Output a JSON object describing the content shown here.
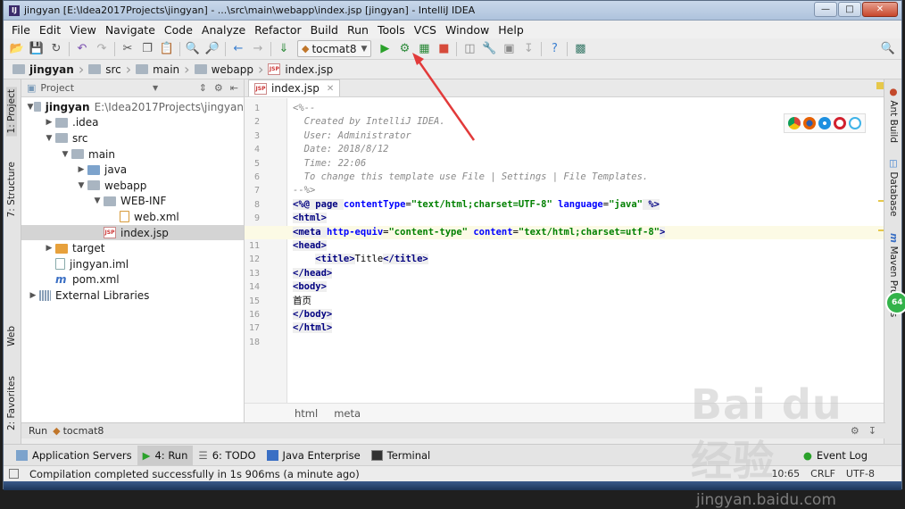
{
  "window": {
    "title": "jingyan [E:\\Idea2017Projects\\jingyan] - ...\\src\\main\\webapp\\index.jsp [jingyan] - IntelliJ IDEA",
    "app_icon": "IJ"
  },
  "menu": [
    "File",
    "Edit",
    "View",
    "Navigate",
    "Code",
    "Analyze",
    "Refactor",
    "Build",
    "Run",
    "Tools",
    "VCS",
    "Window",
    "Help"
  ],
  "toolbar": {
    "run_config": "tocmat8"
  },
  "breadcrumb": [
    {
      "label": "jingyan",
      "bold": true
    },
    {
      "label": "src"
    },
    {
      "label": "main"
    },
    {
      "label": "webapp"
    },
    {
      "label": "index.jsp"
    }
  ],
  "left_strip": {
    "project": "1: Project",
    "structure": "7: Structure",
    "web": "Web",
    "favorites": "2: Favorites"
  },
  "right_strip": {
    "ant": "Ant Build",
    "database": "Database",
    "maven": "Maven Projects"
  },
  "project_panel": {
    "title": "Project",
    "tree": [
      {
        "label": "jingyan",
        "path": "E:\\Idea2017Projects\\jingyan",
        "icon": "module",
        "depth": 0,
        "arrow": "down"
      },
      {
        "label": ".idea",
        "icon": "folder",
        "depth": 1,
        "arrow": "right"
      },
      {
        "label": "src",
        "icon": "folder",
        "depth": 1,
        "arrow": "down"
      },
      {
        "label": "main",
        "icon": "folder",
        "depth": 2,
        "arrow": "down"
      },
      {
        "label": "java",
        "icon": "source-folder",
        "depth": 3,
        "arrow": "right"
      },
      {
        "label": "webapp",
        "icon": "web-folder",
        "depth": 3,
        "arrow": "down"
      },
      {
        "label": "WEB-INF",
        "icon": "folder",
        "depth": 4,
        "arrow": "down"
      },
      {
        "label": "web.xml",
        "icon": "xml-file",
        "depth": 5,
        "arrow": ""
      },
      {
        "label": "index.jsp",
        "icon": "jsp-file",
        "depth": 4,
        "arrow": "",
        "selected": true
      },
      {
        "label": "target",
        "icon": "excluded-folder",
        "depth": 1,
        "arrow": "right"
      },
      {
        "label": "jingyan.iml",
        "icon": "iml-file",
        "depth": 1,
        "arrow": ""
      },
      {
        "label": "pom.xml",
        "icon": "maven-file",
        "depth": 1,
        "arrow": ""
      },
      {
        "label": "External Libraries",
        "icon": "library",
        "depth": 0,
        "arrow": "right"
      }
    ]
  },
  "editor": {
    "tab": "index.jsp",
    "line_numbers": [
      "1",
      "2",
      "3",
      "4",
      "5",
      "6",
      "7",
      "8",
      "9",
      "10",
      "11",
      "12",
      "13",
      "14",
      "15",
      "16",
      "17",
      "18"
    ],
    "current_line": 10,
    "lines": [
      [
        {
          "t": "<%--",
          "c": "com"
        }
      ],
      [
        {
          "t": "  Created by IntelliJ IDEA.",
          "c": "com"
        }
      ],
      [
        {
          "t": "  User: Administrator",
          "c": "com"
        }
      ],
      [
        {
          "t": "  Date: 2018/8/12",
          "c": "com"
        }
      ],
      [
        {
          "t": "  Time: 22:06",
          "c": "com"
        }
      ],
      [
        {
          "t": "  To change this template use File | Settings | File Templates.",
          "c": "com"
        }
      ],
      [
        {
          "t": "--%>",
          "c": "com"
        }
      ],
      [
        {
          "t": "<%@ ",
          "c": "tag"
        },
        {
          "t": "page ",
          "c": "tag"
        },
        {
          "t": "contentType",
          "c": "attr"
        },
        {
          "t": "=",
          "c": "txt"
        },
        {
          "t": "\"text/html;charset=UTF-8\"",
          "c": "val"
        },
        {
          "t": " ",
          "c": "txt"
        },
        {
          "t": "language",
          "c": "attr"
        },
        {
          "t": "=",
          "c": "txt"
        },
        {
          "t": "\"java\"",
          "c": "val"
        },
        {
          "t": " %>",
          "c": "tag"
        }
      ],
      [
        {
          "t": "<html>",
          "c": "tag"
        }
      ],
      [
        {
          "t": "<meta ",
          "c": "tag"
        },
        {
          "t": "http-equiv",
          "c": "attr"
        },
        {
          "t": "=",
          "c": "txt"
        },
        {
          "t": "\"content-type\"",
          "c": "val"
        },
        {
          "t": " ",
          "c": "txt"
        },
        {
          "t": "content",
          "c": "attr"
        },
        {
          "t": "=",
          "c": "txt"
        },
        {
          "t": "\"text/html;charset=utf-8\"",
          "c": "val"
        },
        {
          "t": ">",
          "c": "tag"
        }
      ],
      [
        {
          "t": "<head>",
          "c": "tag"
        }
      ],
      [
        {
          "t": "    ",
          "c": "txt"
        },
        {
          "t": "<title>",
          "c": "tag"
        },
        {
          "t": "Title",
          "c": "txt"
        },
        {
          "t": "</title>",
          "c": "tag"
        }
      ],
      [
        {
          "t": "</head>",
          "c": "tag"
        }
      ],
      [
        {
          "t": "<body>",
          "c": "tag"
        }
      ],
      [
        {
          "t": "首页",
          "c": "txt"
        }
      ],
      [
        {
          "t": "</body>",
          "c": "tag"
        }
      ],
      [
        {
          "t": "</html>",
          "c": "tag"
        }
      ],
      [
        {
          "t": "",
          "c": "txt"
        }
      ]
    ],
    "breadcrumb": [
      "html",
      "meta"
    ]
  },
  "run_panel": {
    "label": "Run",
    "config": "tocmat8"
  },
  "tool_tabs": {
    "app_servers": "Application Servers",
    "run": "4: Run",
    "todo": "6: TODO",
    "java_ee": "Java Enterprise",
    "terminal": "Terminal",
    "event_log": "Event Log"
  },
  "status": {
    "message": "Compilation completed successfully in 1s 906ms (a minute ago)",
    "position": "10:65",
    "line_sep": "CRLF",
    "encoding": "UTF-8"
  },
  "badge": "64",
  "watermark": {
    "big": "Bai du 经验",
    "small": "jingyan.baidu.com"
  },
  "colors": {
    "run_green": "#2aa12a",
    "stop_red": "#d64b3b",
    "annotation_red": "#e23a3a"
  }
}
